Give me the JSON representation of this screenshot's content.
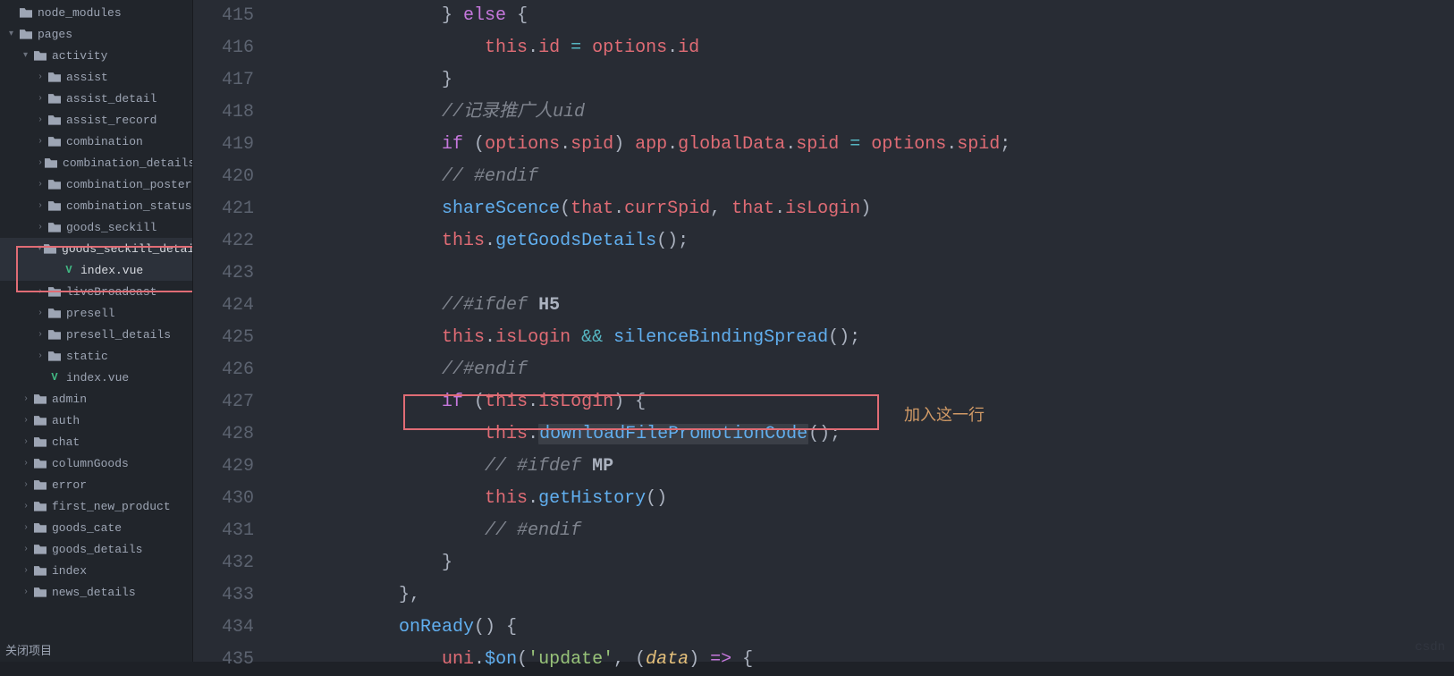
{
  "sidebar": {
    "items": [
      {
        "label": "node_modules",
        "icon": "folder",
        "arrow": "",
        "depth": 0,
        "sel": false
      },
      {
        "label": "pages",
        "icon": "folder",
        "arrow": "▾",
        "depth": 0,
        "sel": false
      },
      {
        "label": "activity",
        "icon": "folder",
        "arrow": "▾",
        "depth": 1,
        "sel": false
      },
      {
        "label": "assist",
        "icon": "folder",
        "arrow": "›",
        "depth": 2,
        "sel": false
      },
      {
        "label": "assist_detail",
        "icon": "folder",
        "arrow": "›",
        "depth": 2,
        "sel": false
      },
      {
        "label": "assist_record",
        "icon": "folder",
        "arrow": "›",
        "depth": 2,
        "sel": false
      },
      {
        "label": "combination",
        "icon": "folder",
        "arrow": "›",
        "depth": 2,
        "sel": false
      },
      {
        "label": "combination_details",
        "icon": "folder",
        "arrow": "›",
        "depth": 2,
        "sel": false
      },
      {
        "label": "combination_poster",
        "icon": "folder",
        "arrow": "›",
        "depth": 2,
        "sel": false
      },
      {
        "label": "combination_status",
        "icon": "folder",
        "arrow": "›",
        "depth": 2,
        "sel": false
      },
      {
        "label": "goods_seckill",
        "icon": "folder",
        "arrow": "›",
        "depth": 2,
        "sel": false
      },
      {
        "label": "goods_seckill_details",
        "icon": "folder",
        "arrow": "▾",
        "depth": 2,
        "sel": true
      },
      {
        "label": "index.vue",
        "icon": "vue",
        "arrow": "",
        "depth": 3,
        "sel": true
      },
      {
        "label": "liveBroadcast",
        "icon": "folder",
        "arrow": "›",
        "depth": 2,
        "sel": false
      },
      {
        "label": "presell",
        "icon": "folder",
        "arrow": "›",
        "depth": 2,
        "sel": false
      },
      {
        "label": "presell_details",
        "icon": "folder",
        "arrow": "›",
        "depth": 2,
        "sel": false
      },
      {
        "label": "static",
        "icon": "folder",
        "arrow": "›",
        "depth": 2,
        "sel": false
      },
      {
        "label": "index.vue",
        "icon": "vue",
        "arrow": "",
        "depth": 2,
        "sel": false
      },
      {
        "label": "admin",
        "icon": "folder",
        "arrow": "›",
        "depth": 1,
        "sel": false
      },
      {
        "label": "auth",
        "icon": "folder",
        "arrow": "›",
        "depth": 1,
        "sel": false
      },
      {
        "label": "chat",
        "icon": "folder",
        "arrow": "›",
        "depth": 1,
        "sel": false
      },
      {
        "label": "columnGoods",
        "icon": "folder",
        "arrow": "›",
        "depth": 1,
        "sel": false
      },
      {
        "label": "error",
        "icon": "folder",
        "arrow": "›",
        "depth": 1,
        "sel": false
      },
      {
        "label": "first_new_product",
        "icon": "folder",
        "arrow": "›",
        "depth": 1,
        "sel": false
      },
      {
        "label": "goods_cate",
        "icon": "folder",
        "arrow": "›",
        "depth": 1,
        "sel": false
      },
      {
        "label": "goods_details",
        "icon": "folder",
        "arrow": "›",
        "depth": 1,
        "sel": false
      },
      {
        "label": "index",
        "icon": "folder",
        "arrow": "›",
        "depth": 1,
        "sel": false
      },
      {
        "label": "news_details",
        "icon": "folder",
        "arrow": "›",
        "depth": 1,
        "sel": false
      }
    ],
    "close_label": "关闭项目"
  },
  "editor": {
    "line_numbers": [
      "415",
      "416",
      "417",
      "418",
      "419",
      "420",
      "421",
      "422",
      "423",
      "424",
      "425",
      "426",
      "427",
      "428",
      "429",
      "430",
      "431",
      "432",
      "433",
      "434",
      "435"
    ],
    "lines": {
      "l415": {
        "indent": "                ",
        "tokens": [
          {
            "t": "} ",
            "c": "punct"
          },
          {
            "t": "else",
            "c": "kw"
          },
          {
            "t": " {",
            "c": "punct"
          }
        ]
      },
      "l416": {
        "indent": "                    ",
        "tokens": [
          {
            "t": "this",
            "c": "this"
          },
          {
            "t": ".",
            "c": "punct"
          },
          {
            "t": "id",
            "c": "prop"
          },
          {
            "t": " = ",
            "c": "op"
          },
          {
            "t": "options",
            "c": "prop"
          },
          {
            "t": ".",
            "c": "punct"
          },
          {
            "t": "id",
            "c": "prop"
          }
        ]
      },
      "l417": {
        "indent": "                ",
        "tokens": [
          {
            "t": "}",
            "c": "punct"
          }
        ]
      },
      "l418": {
        "indent": "                ",
        "tokens": [
          {
            "t": "//记录推广人uid",
            "c": "comment"
          }
        ]
      },
      "l419": {
        "indent": "                ",
        "tokens": [
          {
            "t": "if",
            "c": "kw"
          },
          {
            "t": " (",
            "c": "punct"
          },
          {
            "t": "options",
            "c": "prop"
          },
          {
            "t": ".",
            "c": "punct"
          },
          {
            "t": "spid",
            "c": "prop"
          },
          {
            "t": ") ",
            "c": "punct"
          },
          {
            "t": "app",
            "c": "prop"
          },
          {
            "t": ".",
            "c": "punct"
          },
          {
            "t": "globalData",
            "c": "prop"
          },
          {
            "t": ".",
            "c": "punct"
          },
          {
            "t": "spid",
            "c": "prop"
          },
          {
            "t": " = ",
            "c": "op"
          },
          {
            "t": "options",
            "c": "prop"
          },
          {
            "t": ".",
            "c": "punct"
          },
          {
            "t": "spid",
            "c": "prop"
          },
          {
            "t": ";",
            "c": "punct"
          }
        ]
      },
      "l420": {
        "indent": "                ",
        "tokens": [
          {
            "t": "// #endif",
            "c": "comment"
          }
        ]
      },
      "l421": {
        "indent": "                ",
        "tokens": [
          {
            "t": "shareScence",
            "c": "fn"
          },
          {
            "t": "(",
            "c": "punct"
          },
          {
            "t": "that",
            "c": "prop"
          },
          {
            "t": ".",
            "c": "punct"
          },
          {
            "t": "currSpid",
            "c": "prop"
          },
          {
            "t": ", ",
            "c": "punct"
          },
          {
            "t": "that",
            "c": "prop"
          },
          {
            "t": ".",
            "c": "punct"
          },
          {
            "t": "isLogin",
            "c": "prop"
          },
          {
            "t": ")",
            "c": "punct"
          }
        ]
      },
      "l422": {
        "indent": "                ",
        "tokens": [
          {
            "t": "this",
            "c": "this"
          },
          {
            "t": ".",
            "c": "punct"
          },
          {
            "t": "getGoodsDetails",
            "c": "fn"
          },
          {
            "t": "();",
            "c": "punct"
          }
        ]
      },
      "l423": {
        "indent": "",
        "tokens": []
      },
      "l424": {
        "indent": "                ",
        "tokens": [
          {
            "t": "//#ifdef ",
            "c": "comment"
          },
          {
            "t": "H5",
            "c": "bold"
          }
        ]
      },
      "l425": {
        "indent": "                ",
        "tokens": [
          {
            "t": "this",
            "c": "this"
          },
          {
            "t": ".",
            "c": "punct"
          },
          {
            "t": "isLogin",
            "c": "prop"
          },
          {
            "t": " && ",
            "c": "op"
          },
          {
            "t": "silenceBindingSpread",
            "c": "fn"
          },
          {
            "t": "();",
            "c": "punct"
          }
        ]
      },
      "l426": {
        "indent": "                ",
        "tokens": [
          {
            "t": "//#endif",
            "c": "comment"
          }
        ]
      },
      "l427": {
        "indent": "                ",
        "tokens": [
          {
            "t": "if",
            "c": "kw"
          },
          {
            "t": " (",
            "c": "punct"
          },
          {
            "t": "this",
            "c": "this"
          },
          {
            "t": ".",
            "c": "punct"
          },
          {
            "t": "isLogin",
            "c": "prop"
          },
          {
            "t": ") {",
            "c": "punct"
          }
        ]
      },
      "l428": {
        "indent": "                    ",
        "tokens": [
          {
            "t": "this",
            "c": "this"
          },
          {
            "t": ".",
            "c": "punct"
          },
          {
            "t": "downloadFilePromotionCode",
            "c": "fn",
            "bg": true
          },
          {
            "t": "();",
            "c": "punct"
          }
        ]
      },
      "l429": {
        "indent": "                    ",
        "tokens": [
          {
            "t": "// #ifdef ",
            "c": "comment"
          },
          {
            "t": "MP",
            "c": "bold"
          }
        ]
      },
      "l430": {
        "indent": "                    ",
        "tokens": [
          {
            "t": "this",
            "c": "this"
          },
          {
            "t": ".",
            "c": "punct"
          },
          {
            "t": "getHistory",
            "c": "fn"
          },
          {
            "t": "()",
            "c": "punct"
          }
        ]
      },
      "l431": {
        "indent": "                    ",
        "tokens": [
          {
            "t": "// #endif",
            "c": "comment"
          }
        ]
      },
      "l432": {
        "indent": "                ",
        "tokens": [
          {
            "t": "}",
            "c": "punct"
          }
        ]
      },
      "l433": {
        "indent": "            ",
        "tokens": [
          {
            "t": "},",
            "c": "punct"
          }
        ]
      },
      "l434": {
        "indent": "            ",
        "tokens": [
          {
            "t": "onReady",
            "c": "fn"
          },
          {
            "t": "() {",
            "c": "punct"
          }
        ]
      },
      "l435": {
        "indent": "                ",
        "tokens": [
          {
            "t": "uni",
            "c": "prop"
          },
          {
            "t": ".",
            "c": "punct"
          },
          {
            "t": "$on",
            "c": "fn"
          },
          {
            "t": "(",
            "c": "punct"
          },
          {
            "t": "'update'",
            "c": "str"
          },
          {
            "t": ", (",
            "c": "punct"
          },
          {
            "t": "data",
            "c": "param"
          },
          {
            "t": ") ",
            "c": "punct"
          },
          {
            "t": "=>",
            "c": "arrow"
          },
          {
            "t": " {",
            "c": "punct"
          }
        ]
      }
    },
    "annotation": "加入这一行"
  },
  "watermark": "csdn"
}
